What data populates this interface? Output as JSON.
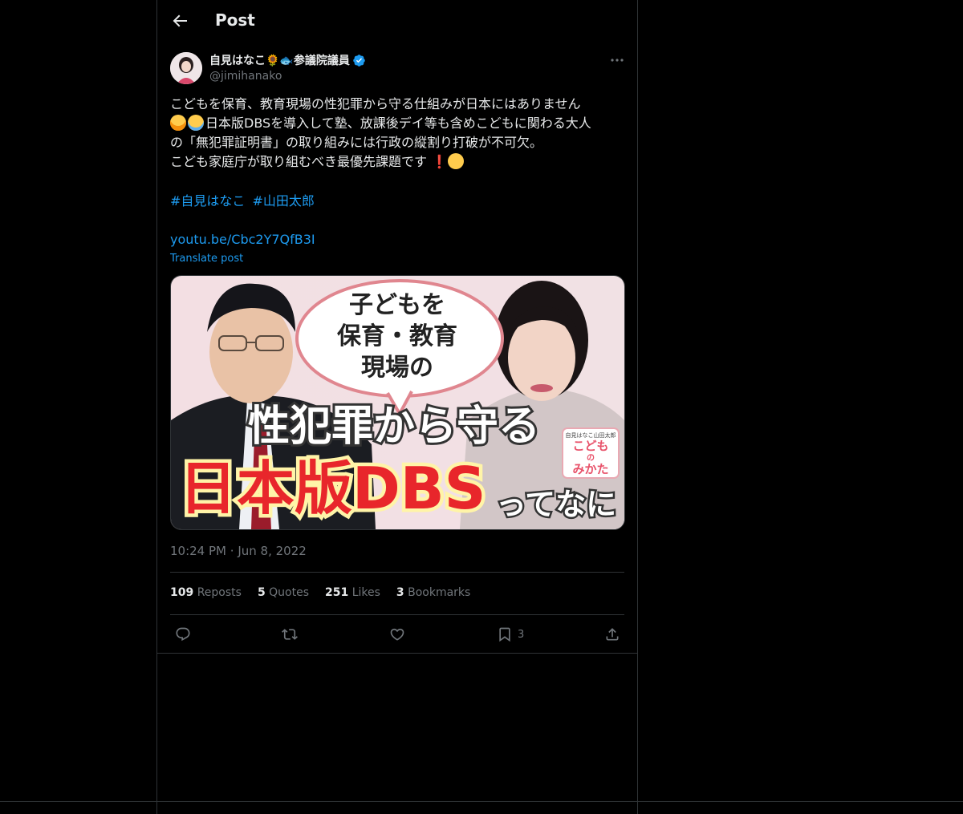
{
  "header": {
    "title": "Post"
  },
  "author": {
    "name": "自見はなこ🌻🐟参議院議員",
    "handle": "@jimihanako"
  },
  "post": {
    "line1": "こどもを保育、教育現場の性犯罪から守る仕組みが日本にはありません",
    "line2": "日本版DBSを導入して塾、放課後デイ等も含めこどもに関わる大人",
    "line3": "の「無犯罪証明書」の取り組みには行政の縦割り打破が不可欠。",
    "line4": "こども家庭庁が取り組むべき最優先課題です",
    "hashtags": [
      "#自見はなこ",
      "#山田太郎"
    ],
    "link": "youtu.be/Cbc2Y7QfB3I",
    "translate": "Translate post"
  },
  "media": {
    "bubble_line1": "子どもを",
    "bubble_line2": "保育・教育",
    "bubble_line3": "現場の",
    "headline1": "性犯罪から守る",
    "headline2": "日本版DBS",
    "headline_suffix": "ってなに",
    "logo_top": "自見はなこ山田太郎",
    "logo_line1": "こども",
    "logo_line2": "の",
    "logo_line3": "みかた"
  },
  "meta": {
    "time": "10:24 PM",
    "separator": "·",
    "date": "Jun 8, 2022"
  },
  "stats": {
    "reposts_count": "109",
    "reposts_label": "Reposts",
    "quotes_count": "5",
    "quotes_label": "Quotes",
    "likes_count": "251",
    "likes_label": "Likes",
    "bookmarks_count": "3",
    "bookmarks_label": "Bookmarks"
  },
  "actions": {
    "bookmark_count": "3"
  },
  "colors": {
    "accent": "#1d9bf0",
    "muted": "#71767b",
    "text": "#e7e9ea",
    "divider": "#2f3336",
    "headline_red": "#e8262b"
  }
}
